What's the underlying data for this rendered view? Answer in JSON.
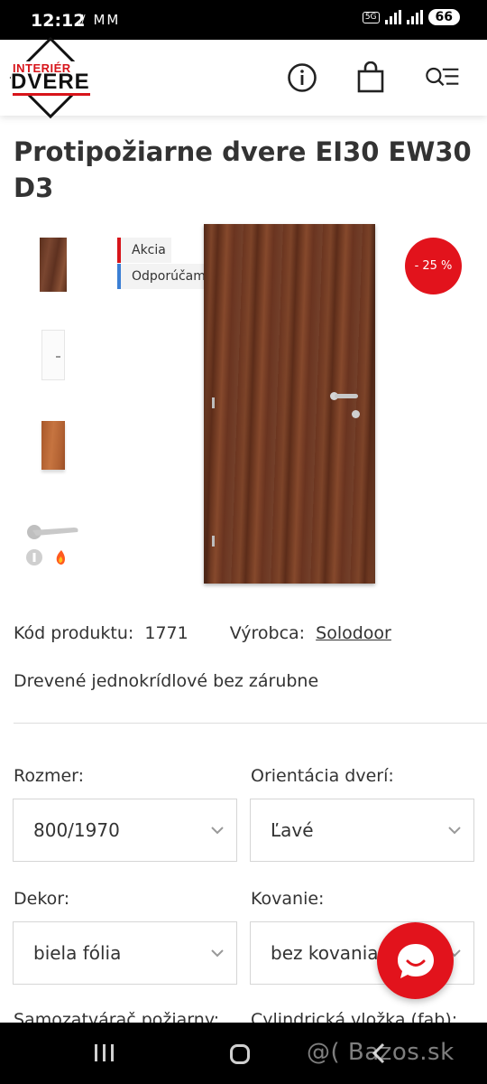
{
  "status_bar": {
    "time": "12:12",
    "left_icons": "⫽ ⅯⅯ",
    "network": "5G",
    "battery": "66"
  },
  "header": {
    "logo_top": "INTERIÉR",
    "logo_bottom": "DVERE",
    "icons": [
      "info-icon",
      "shopping-bag-icon",
      "search-menu-icon"
    ]
  },
  "product": {
    "title": "Protipožiarne dvere EI30 EW30 D3",
    "badges": [
      "Akcia",
      "Odporúčame"
    ],
    "discount": "- 25 %",
    "code_label": "Kód produktu:",
    "code_value": "1771",
    "maker_label": "Výrobca:",
    "maker_value": "Solodoor",
    "description": "Drevené jednokrídlové bez zárubne"
  },
  "options": {
    "size_label": "Rozmer:",
    "size_value": "800/1970",
    "orientation_label": "Orientácia dverí:",
    "orientation_value": "Ľavé",
    "decor_label": "Dekor:",
    "decor_value": "biela fólia",
    "fittings_label": "Kovanie:",
    "fittings_value": "bez kovania",
    "closer_label": "Samozatvárač požiarny:",
    "cylinder_label": "Cylindrická vložka (fab):"
  },
  "watermark": "@( Bazos.sk",
  "colors": {
    "brand_red": "#e2131c",
    "badge_blue": "#3b7fd4"
  }
}
